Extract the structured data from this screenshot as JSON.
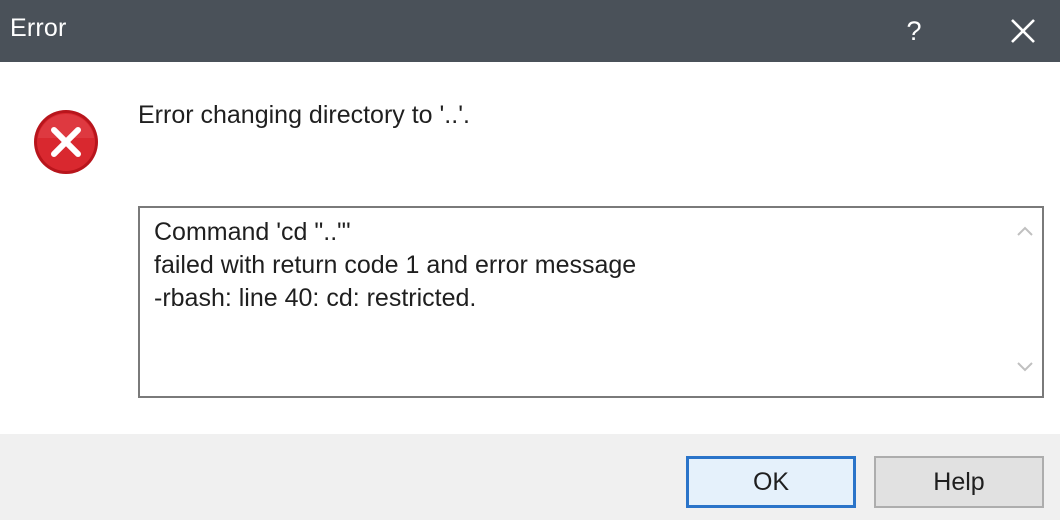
{
  "window": {
    "title": "Error",
    "help_glyph": "?",
    "icons": {
      "help": "help-question-icon",
      "close": "close-icon",
      "error": "error-circle-icon",
      "scroll_up": "chevron-up-icon",
      "scroll_down": "chevron-down-icon"
    }
  },
  "message": "Error changing directory to '..'.",
  "details": {
    "line1": "Command 'cd \"..\"'",
    "line2": "failed with return code 1 and error message",
    "line3": "-rbash: line 40: cd: restricted."
  },
  "buttons": {
    "ok": "OK",
    "help": "Help"
  },
  "colors": {
    "titlebar": "#4a5159",
    "error_icon": "#d9282f",
    "ok_border": "#2a74c9",
    "footer": "#f0f0f0"
  }
}
